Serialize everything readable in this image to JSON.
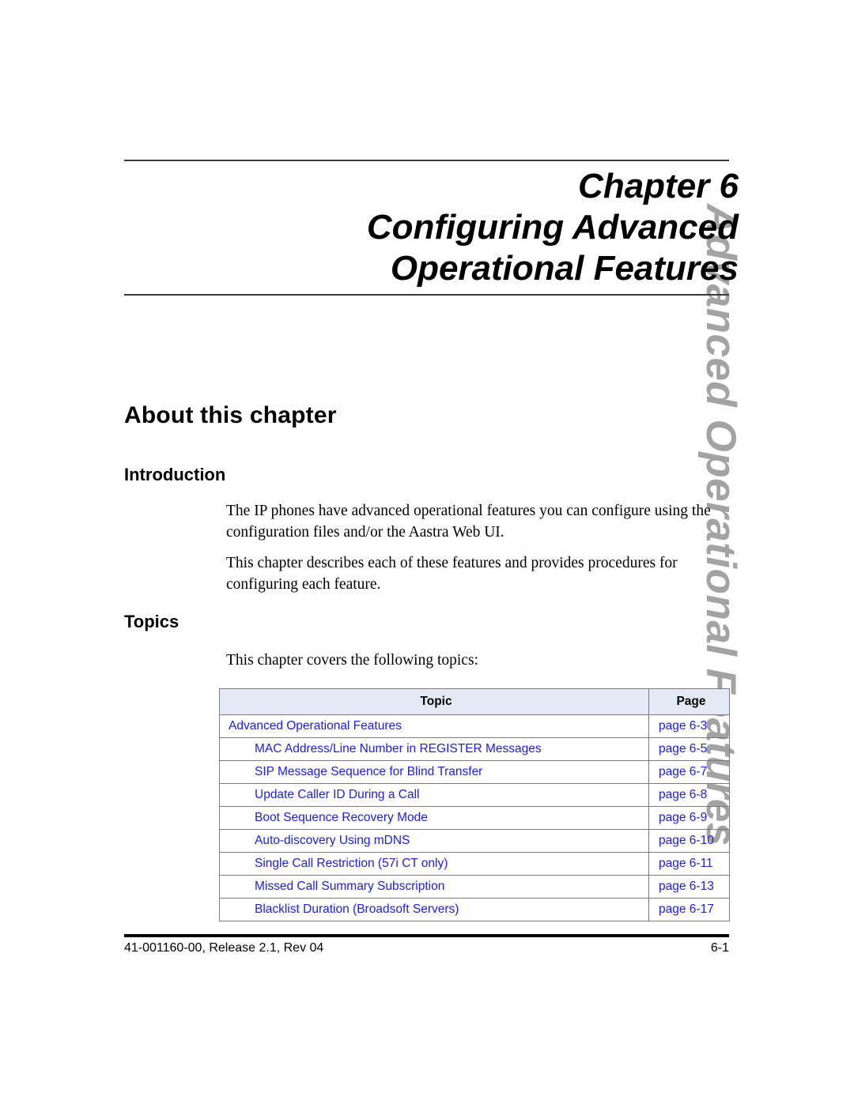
{
  "side_tab": {
    "text": "Advanced Operational Features",
    "color": "#a3a3a3"
  },
  "chapter": {
    "line1": "Chapter  6",
    "line2": "Configuring Advanced",
    "line3": "Operational Features"
  },
  "sections": {
    "about_heading": "About this chapter",
    "introduction_heading": "Introduction",
    "intro_para_1": "The IP phones have advanced operational features you can configure using the configuration files and/or the Aastra Web UI.",
    "intro_para_2": "This chapter describes each of these features and provides procedures for configuring each feature.",
    "topics_heading": "Topics",
    "topics_intro": "This chapter covers the following topics:"
  },
  "topics_table": {
    "headers": {
      "topic": "Topic",
      "page": "Page"
    },
    "link_color": "#2020e0",
    "header_bg": "#e3eaf6",
    "rows": [
      {
        "topic": "Advanced Operational Features",
        "page": "page 6-3",
        "indent": false
      },
      {
        "topic": "MAC Address/Line Number in REGISTER Messages",
        "page": "page 6-5",
        "indent": true
      },
      {
        "topic": "SIP Message Sequence for Blind Transfer",
        "page": "page 6-7",
        "indent": true
      },
      {
        "topic": "Update Caller ID During a Call",
        "page": "page 6-8",
        "indent": true
      },
      {
        "topic": "Boot Sequence Recovery Mode",
        "page": "page 6-9",
        "indent": true
      },
      {
        "topic": "Auto-discovery Using mDNS",
        "page": "page 6-10",
        "indent": true
      },
      {
        "topic": "Single Call Restriction (57i CT only)",
        "page": "page 6-11",
        "indent": true
      },
      {
        "topic": "Missed Call Summary Subscription",
        "page": "page 6-13",
        "indent": true
      },
      {
        "topic": "Blacklist Duration (Broadsoft Servers)",
        "page": "page 6-17",
        "indent": true
      }
    ]
  },
  "footer": {
    "left": "41-001160-00, Release 2.1, Rev 04",
    "right": "6-1"
  }
}
